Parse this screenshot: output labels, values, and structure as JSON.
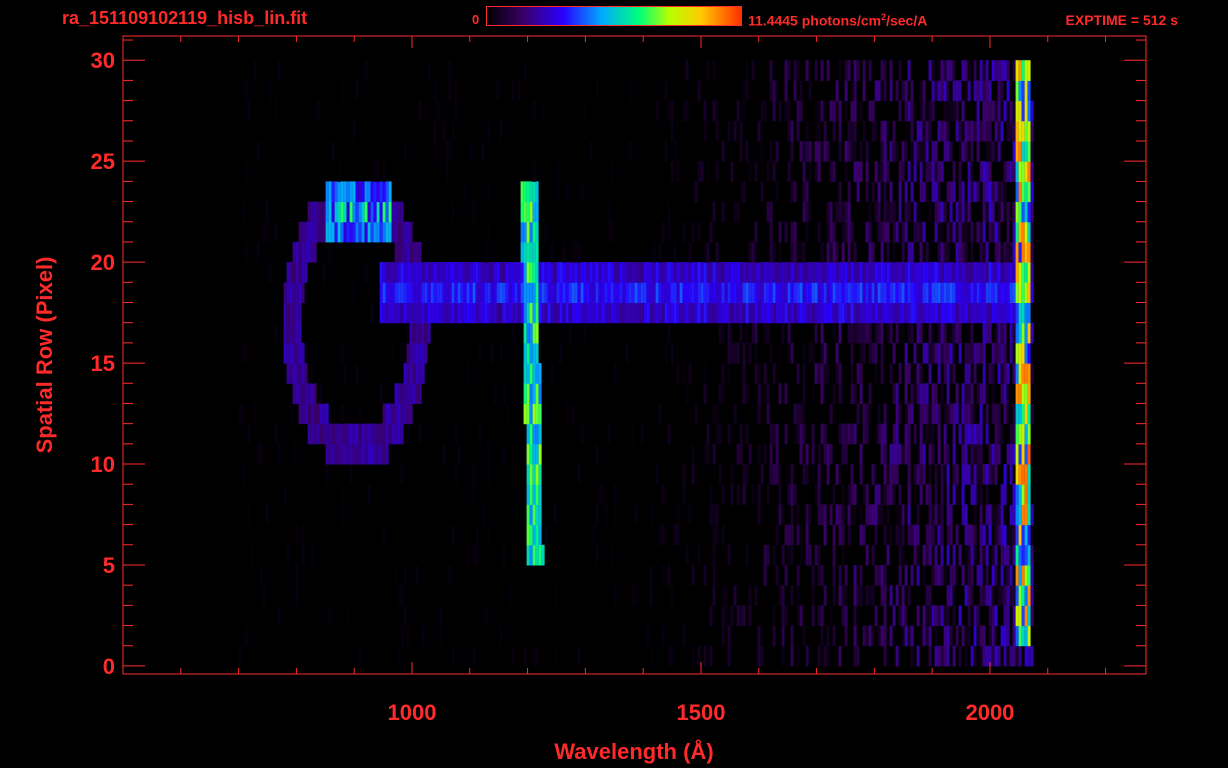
{
  "header": {
    "file_name": "ra_151109102119_hisb_lin.fit",
    "colorbar_min": "0",
    "colorbar_max_value": "11.4445",
    "colorbar_unit_prefix": "photons/cm",
    "colorbar_unit_power": "2",
    "colorbar_unit_suffix": "/sec/A",
    "exptime": "EXPTIME = 512 s"
  },
  "colors": {
    "frame": "#ff2a2a",
    "background": "#000000"
  },
  "chart_data": {
    "type": "heatmap",
    "xlabel": "Wavelength (Å)",
    "ylabel": "Spatial Row (Pixel)",
    "xlim": [
      500,
      2270
    ],
    "ylim": [
      -0.4,
      31.2
    ],
    "x_ticks": [
      1000,
      1500,
      2000
    ],
    "x_tick_labels": [
      "1000",
      "1500",
      "2000"
    ],
    "y_ticks": [
      0,
      5,
      10,
      15,
      20,
      25,
      30
    ],
    "y_tick_labels": [
      "0",
      "5",
      "10",
      "15",
      "20",
      "25",
      "30"
    ],
    "colorbar_range": [
      0,
      11.4445
    ],
    "features": [
      {
        "label_text": "",
        "x_from": 1200,
        "x_to": 1225,
        "y_from": 5,
        "y_to": 24,
        "intensity": 0.55
      },
      {
        "label_text": "",
        "x_from": 940,
        "x_to": 2060,
        "y_from": 18,
        "y_to": 19,
        "intensity": 0.3
      },
      {
        "label_text": "",
        "x_from": 850,
        "x_to": 930,
        "y_from": 22,
        "y_to": 23,
        "intensity": 0.6
      },
      {
        "label_text": "",
        "x_from": 2050,
        "x_to": 2070,
        "y_from": 1,
        "y_to": 30,
        "intensity": 0.8
      }
    ]
  }
}
